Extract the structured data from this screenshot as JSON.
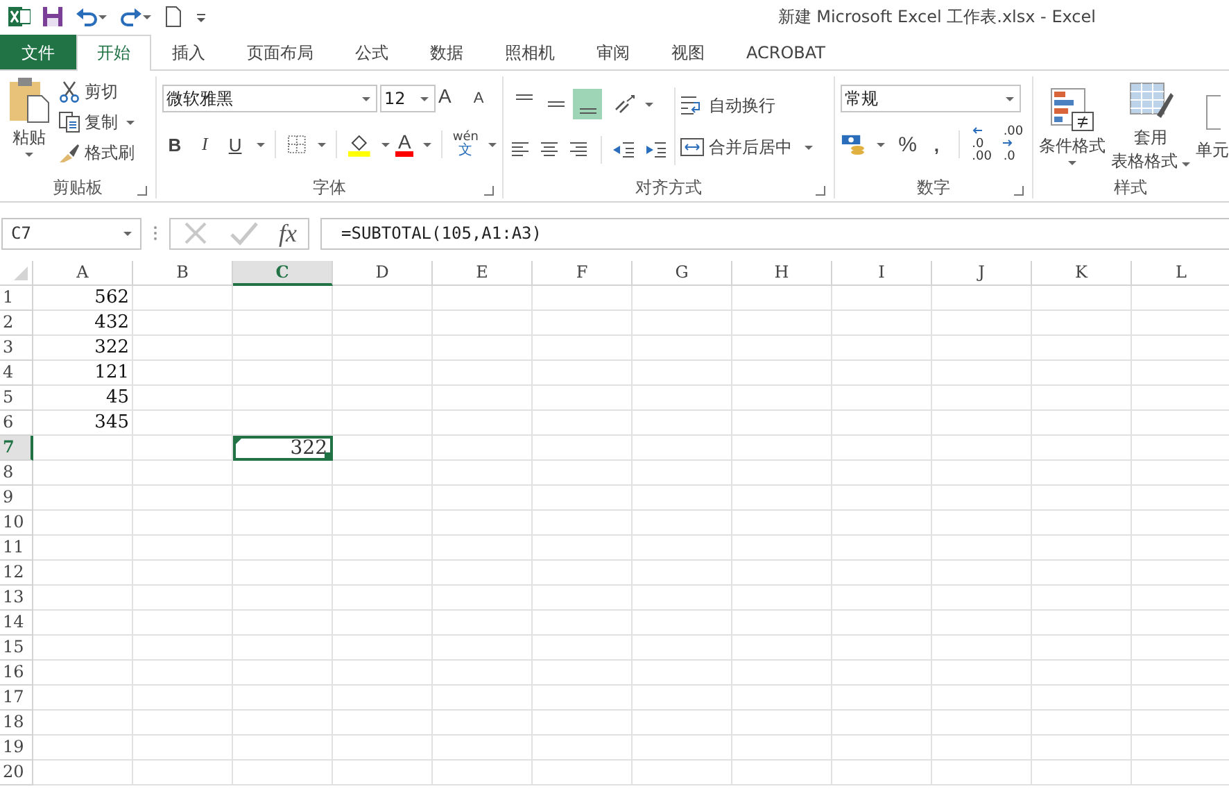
{
  "window": {
    "title": "新建 Microsoft Excel 工作表.xlsx - Excel"
  },
  "tabs": [
    {
      "label": "文件",
      "kind": "file",
      "selected": false
    },
    {
      "label": "开始",
      "kind": "tab",
      "selected": true
    },
    {
      "label": "插入",
      "kind": "tab",
      "selected": false
    },
    {
      "label": "页面布局",
      "kind": "tab",
      "selected": false
    },
    {
      "label": "公式",
      "kind": "tab",
      "selected": false
    },
    {
      "label": "数据",
      "kind": "tab",
      "selected": false
    },
    {
      "label": "照相机",
      "kind": "tab",
      "selected": false
    },
    {
      "label": "审阅",
      "kind": "tab",
      "selected": false
    },
    {
      "label": "视图",
      "kind": "tab",
      "selected": false
    },
    {
      "label": "ACROBAT",
      "kind": "tab",
      "selected": false
    }
  ],
  "ribbon": {
    "clipboard": {
      "label": "剪贴板",
      "paste": "粘贴",
      "cut": "剪切",
      "copy": "复制",
      "format_painter": "格式刷"
    },
    "font": {
      "label": "字体",
      "font_name": "微软雅黑",
      "font_size": "12",
      "size_buttons": [
        {
          "kind": "grow",
          "label": "A"
        },
        {
          "kind": "shrink",
          "label": "A"
        }
      ],
      "style_buttons": [
        {
          "kind": "bold",
          "label": "B"
        },
        {
          "kind": "italic",
          "label": "I"
        },
        {
          "kind": "underline",
          "label": "U"
        }
      ],
      "font_color": {
        "label": "A",
        "color": "#ff0000"
      },
      "phonetic": {
        "top": "wén",
        "bottom": "文"
      }
    },
    "alignment": {
      "label": "对齐方式",
      "vertical": [
        {
          "kind": "top",
          "selected": false
        },
        {
          "kind": "middle",
          "selected": false
        },
        {
          "kind": "bottom",
          "selected": true
        }
      ],
      "wrap_text": "自动换行",
      "merge_center": "合并后居中"
    },
    "number": {
      "label": "数字",
      "format": "常规",
      "percent": "%",
      "comma": ",",
      "decimals": [
        {
          "kind": "increase",
          "top": ".0",
          "bottom": ".00"
        },
        {
          "kind": "decrease",
          "top": ".00",
          "bottom": ".0"
        }
      ]
    },
    "styles": {
      "label": "样式",
      "conditional": "条件格式",
      "table_format": [
        "套用",
        "表格格式"
      ],
      "cell_styles": "单元"
    }
  },
  "formula_bar": {
    "name_box": "C7",
    "fx": "fx",
    "formula": "=SUBTOTAL(105,A1:A3)"
  },
  "sheet": {
    "columns": [
      {
        "label": "A",
        "selected": false,
        "values": [
          "562",
          "432",
          "322",
          "121",
          "45",
          "345"
        ]
      },
      {
        "label": "B",
        "selected": false
      },
      {
        "label": "C",
        "selected": true
      },
      {
        "label": "D",
        "selected": false
      },
      {
        "label": "E",
        "selected": false
      },
      {
        "label": "F",
        "selected": false
      },
      {
        "label": "G",
        "selected": false
      },
      {
        "label": "H",
        "selected": false
      },
      {
        "label": "I",
        "selected": false
      },
      {
        "label": "J",
        "selected": false
      },
      {
        "label": "K",
        "selected": false
      },
      {
        "label": "L",
        "selected": false
      }
    ],
    "rows": [
      {
        "label": "1",
        "selected": false
      },
      {
        "label": "2",
        "selected": false
      },
      {
        "label": "3",
        "selected": false
      },
      {
        "label": "4",
        "selected": false
      },
      {
        "label": "5",
        "selected": false
      },
      {
        "label": "6",
        "selected": false
      },
      {
        "label": "7",
        "selected": true
      },
      {
        "label": "8",
        "selected": false
      },
      {
        "label": "9",
        "selected": false
      },
      {
        "label": "10",
        "selected": false
      },
      {
        "label": "11",
        "selected": false
      },
      {
        "label": "12",
        "selected": false
      },
      {
        "label": "13",
        "selected": false
      },
      {
        "label": "14",
        "selected": false
      },
      {
        "label": "15",
        "selected": false
      },
      {
        "label": "16",
        "selected": false
      },
      {
        "label": "17",
        "selected": false
      },
      {
        "label": "18",
        "selected": false
      },
      {
        "label": "19",
        "selected": false
      },
      {
        "label": "20",
        "selected": false
      }
    ],
    "active_cell_value": "322"
  }
}
